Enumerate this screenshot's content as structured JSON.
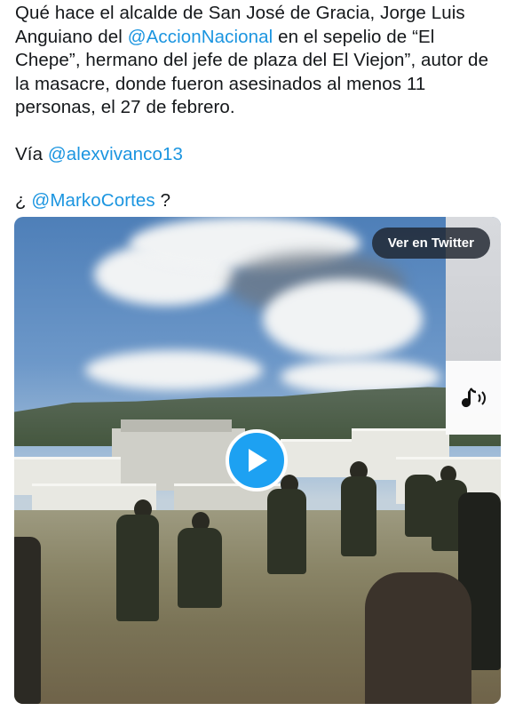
{
  "tweet": {
    "line1_prefix": "Qué hace el alcalde de San José de Gracia, Jorge Luis Anguiano del ",
    "mention1": "@AccionNacional",
    "line1_suffix": " en el sepelio de “El Chepe”, hermano del jefe de plaza del El Viejon”, autor de la masacre, donde fueron asesinados al menos 11 personas, el 27 de febrero.",
    "via_prefix": "Vía ",
    "mention2": "@alexvivanco13",
    "question_prefix": "¿ ",
    "mention3": "@MarkoCortes",
    "question_suffix": " ?"
  },
  "video": {
    "watch_label": "Ver en Twitter",
    "play_icon": "play-icon",
    "sound_icon": "tiktok-sound-icon"
  },
  "colors": {
    "mention": "#1b95e0",
    "play_button": "#1da1f2",
    "text": "#14171a"
  }
}
